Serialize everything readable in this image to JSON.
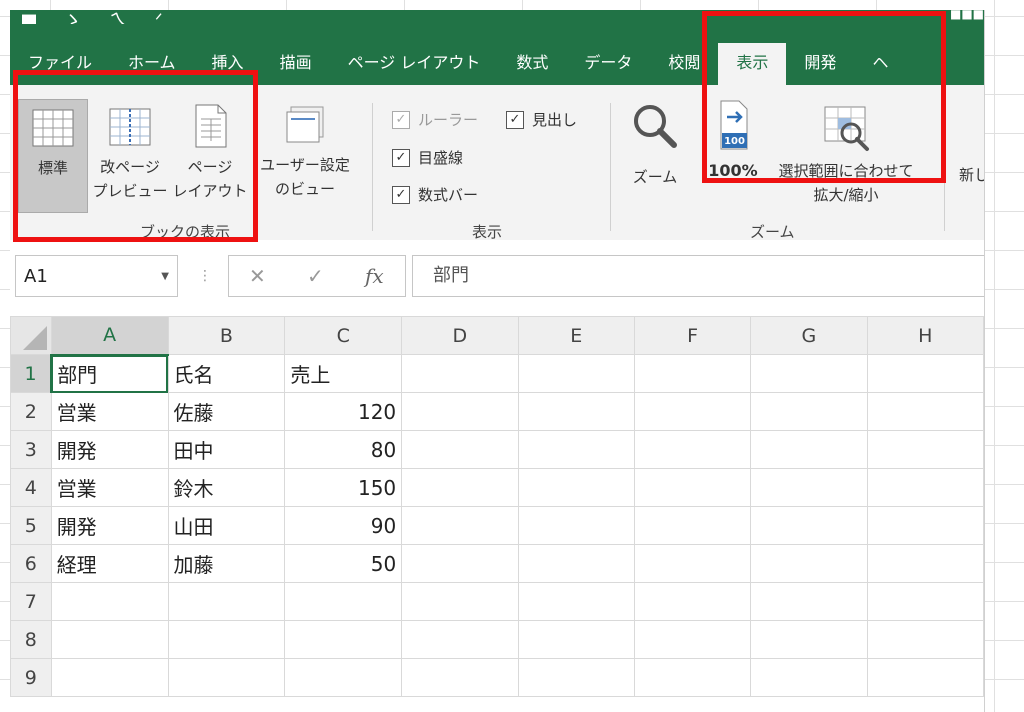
{
  "tabs": [
    "ファイル",
    "ホーム",
    "挿入",
    "描画",
    "ページ レイアウト",
    "数式",
    "データ",
    "校閲",
    "表示",
    "開発",
    "ヘ"
  ],
  "active_tab": "表示",
  "ribbon": {
    "book_view": {
      "label": "ブックの表示",
      "normal": "標準",
      "page_break_l1": "改ページ",
      "page_break_l2": "プレビュー",
      "page_layout_l1": "ページ",
      "page_layout_l2": "レイアウト",
      "custom_l1": "ユーザー設定",
      "custom_l2": "のビュー"
    },
    "show": {
      "label": "表示",
      "ruler": "ルーラー",
      "headings": "見出し",
      "gridlines": "目盛線",
      "formula_bar": "数式バー"
    },
    "zoom": {
      "label": "ズーム",
      "zoom_btn": "ズーム",
      "hundred": "100%",
      "fit_selection": "選択範囲に合わせて",
      "fit_selection_l2": "拡大/縮小",
      "icon_100": "100"
    },
    "next": "新し"
  },
  "formula_bar": {
    "name_box": "A1",
    "cancel": "✕",
    "enter": "✓",
    "fx": "fx",
    "content": "部門"
  },
  "sheet": {
    "columns": [
      "A",
      "B",
      "C",
      "D",
      "E",
      "F",
      "G",
      "H"
    ],
    "rows": [
      {
        "n": "1",
        "a": "部門",
        "b": "氏名",
        "c": "売上"
      },
      {
        "n": "2",
        "a": "営業",
        "b": "佐藤",
        "c": "120"
      },
      {
        "n": "3",
        "a": "開発",
        "b": "田中",
        "c": "80"
      },
      {
        "n": "4",
        "a": "営業",
        "b": "鈴木",
        "c": "150"
      },
      {
        "n": "5",
        "a": "開発",
        "b": "山田",
        "c": "90"
      },
      {
        "n": "6",
        "a": "経理",
        "b": "加藤",
        "c": "50"
      },
      {
        "n": "7",
        "a": "",
        "b": "",
        "c": ""
      },
      {
        "n": "8",
        "a": "",
        "b": "",
        "c": ""
      },
      {
        "n": "9",
        "a": "",
        "b": "",
        "c": ""
      }
    ]
  },
  "colors": {
    "excel_green": "#217346",
    "highlight_red": "#ee1111"
  }
}
